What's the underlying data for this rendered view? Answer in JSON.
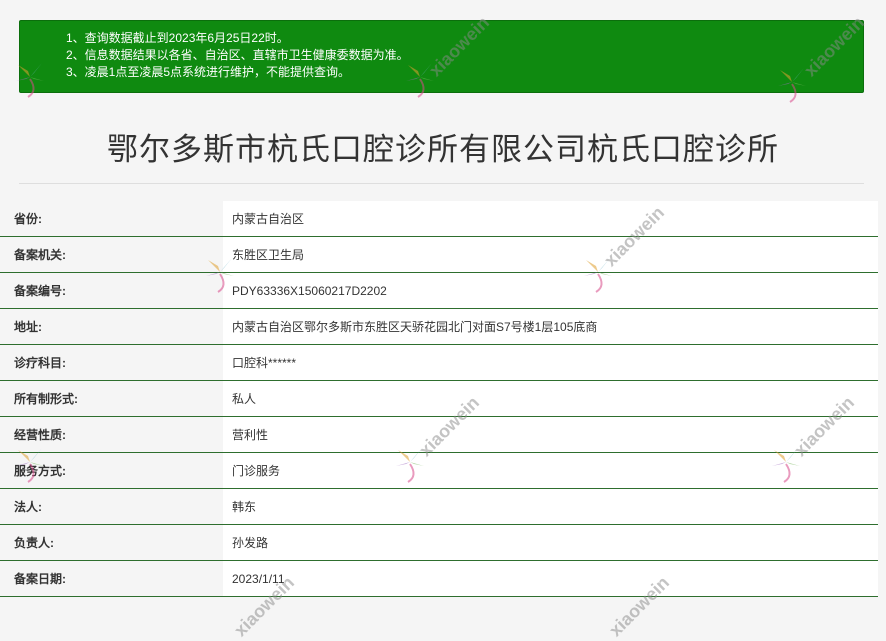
{
  "notice": {
    "lines": [
      "1、查询数据截止到2023年6月25日22时。",
      "2、信息数据结果以各省、自治区、直辖市卫生健康委数据为准。",
      "3、凌晨1点至凌晨5点系统进行维护，不能提供查询。"
    ],
    "background": "#0f8a10"
  },
  "title": "鄂尔多斯市杭氏口腔诊所有限公司杭氏口腔诊所",
  "rows": [
    {
      "label": "省份:",
      "value": "内蒙古自治区"
    },
    {
      "label": "备案机关:",
      "value": "东胜区卫生局"
    },
    {
      "label": "备案编号:",
      "value": "PDY63336X15060217D2202"
    },
    {
      "label": "地址:",
      "value": "内蒙古自治区鄂尔多斯市东胜区天骄花园北门对面S7号楼1层105底商"
    },
    {
      "label": "诊疗科目:",
      "value": "口腔科******"
    },
    {
      "label": "所有制形式:",
      "value": "私人"
    },
    {
      "label": "经营性质:",
      "value": "营利性"
    },
    {
      "label": "服务方式:",
      "value": "门诊服务"
    },
    {
      "label": "法人:",
      "value": "韩东"
    },
    {
      "label": "负责人:",
      "value": "孙发路"
    },
    {
      "label": "备案日期:",
      "value": "2023/1/11"
    }
  ],
  "watermarks": {
    "text": "xiaowein"
  }
}
